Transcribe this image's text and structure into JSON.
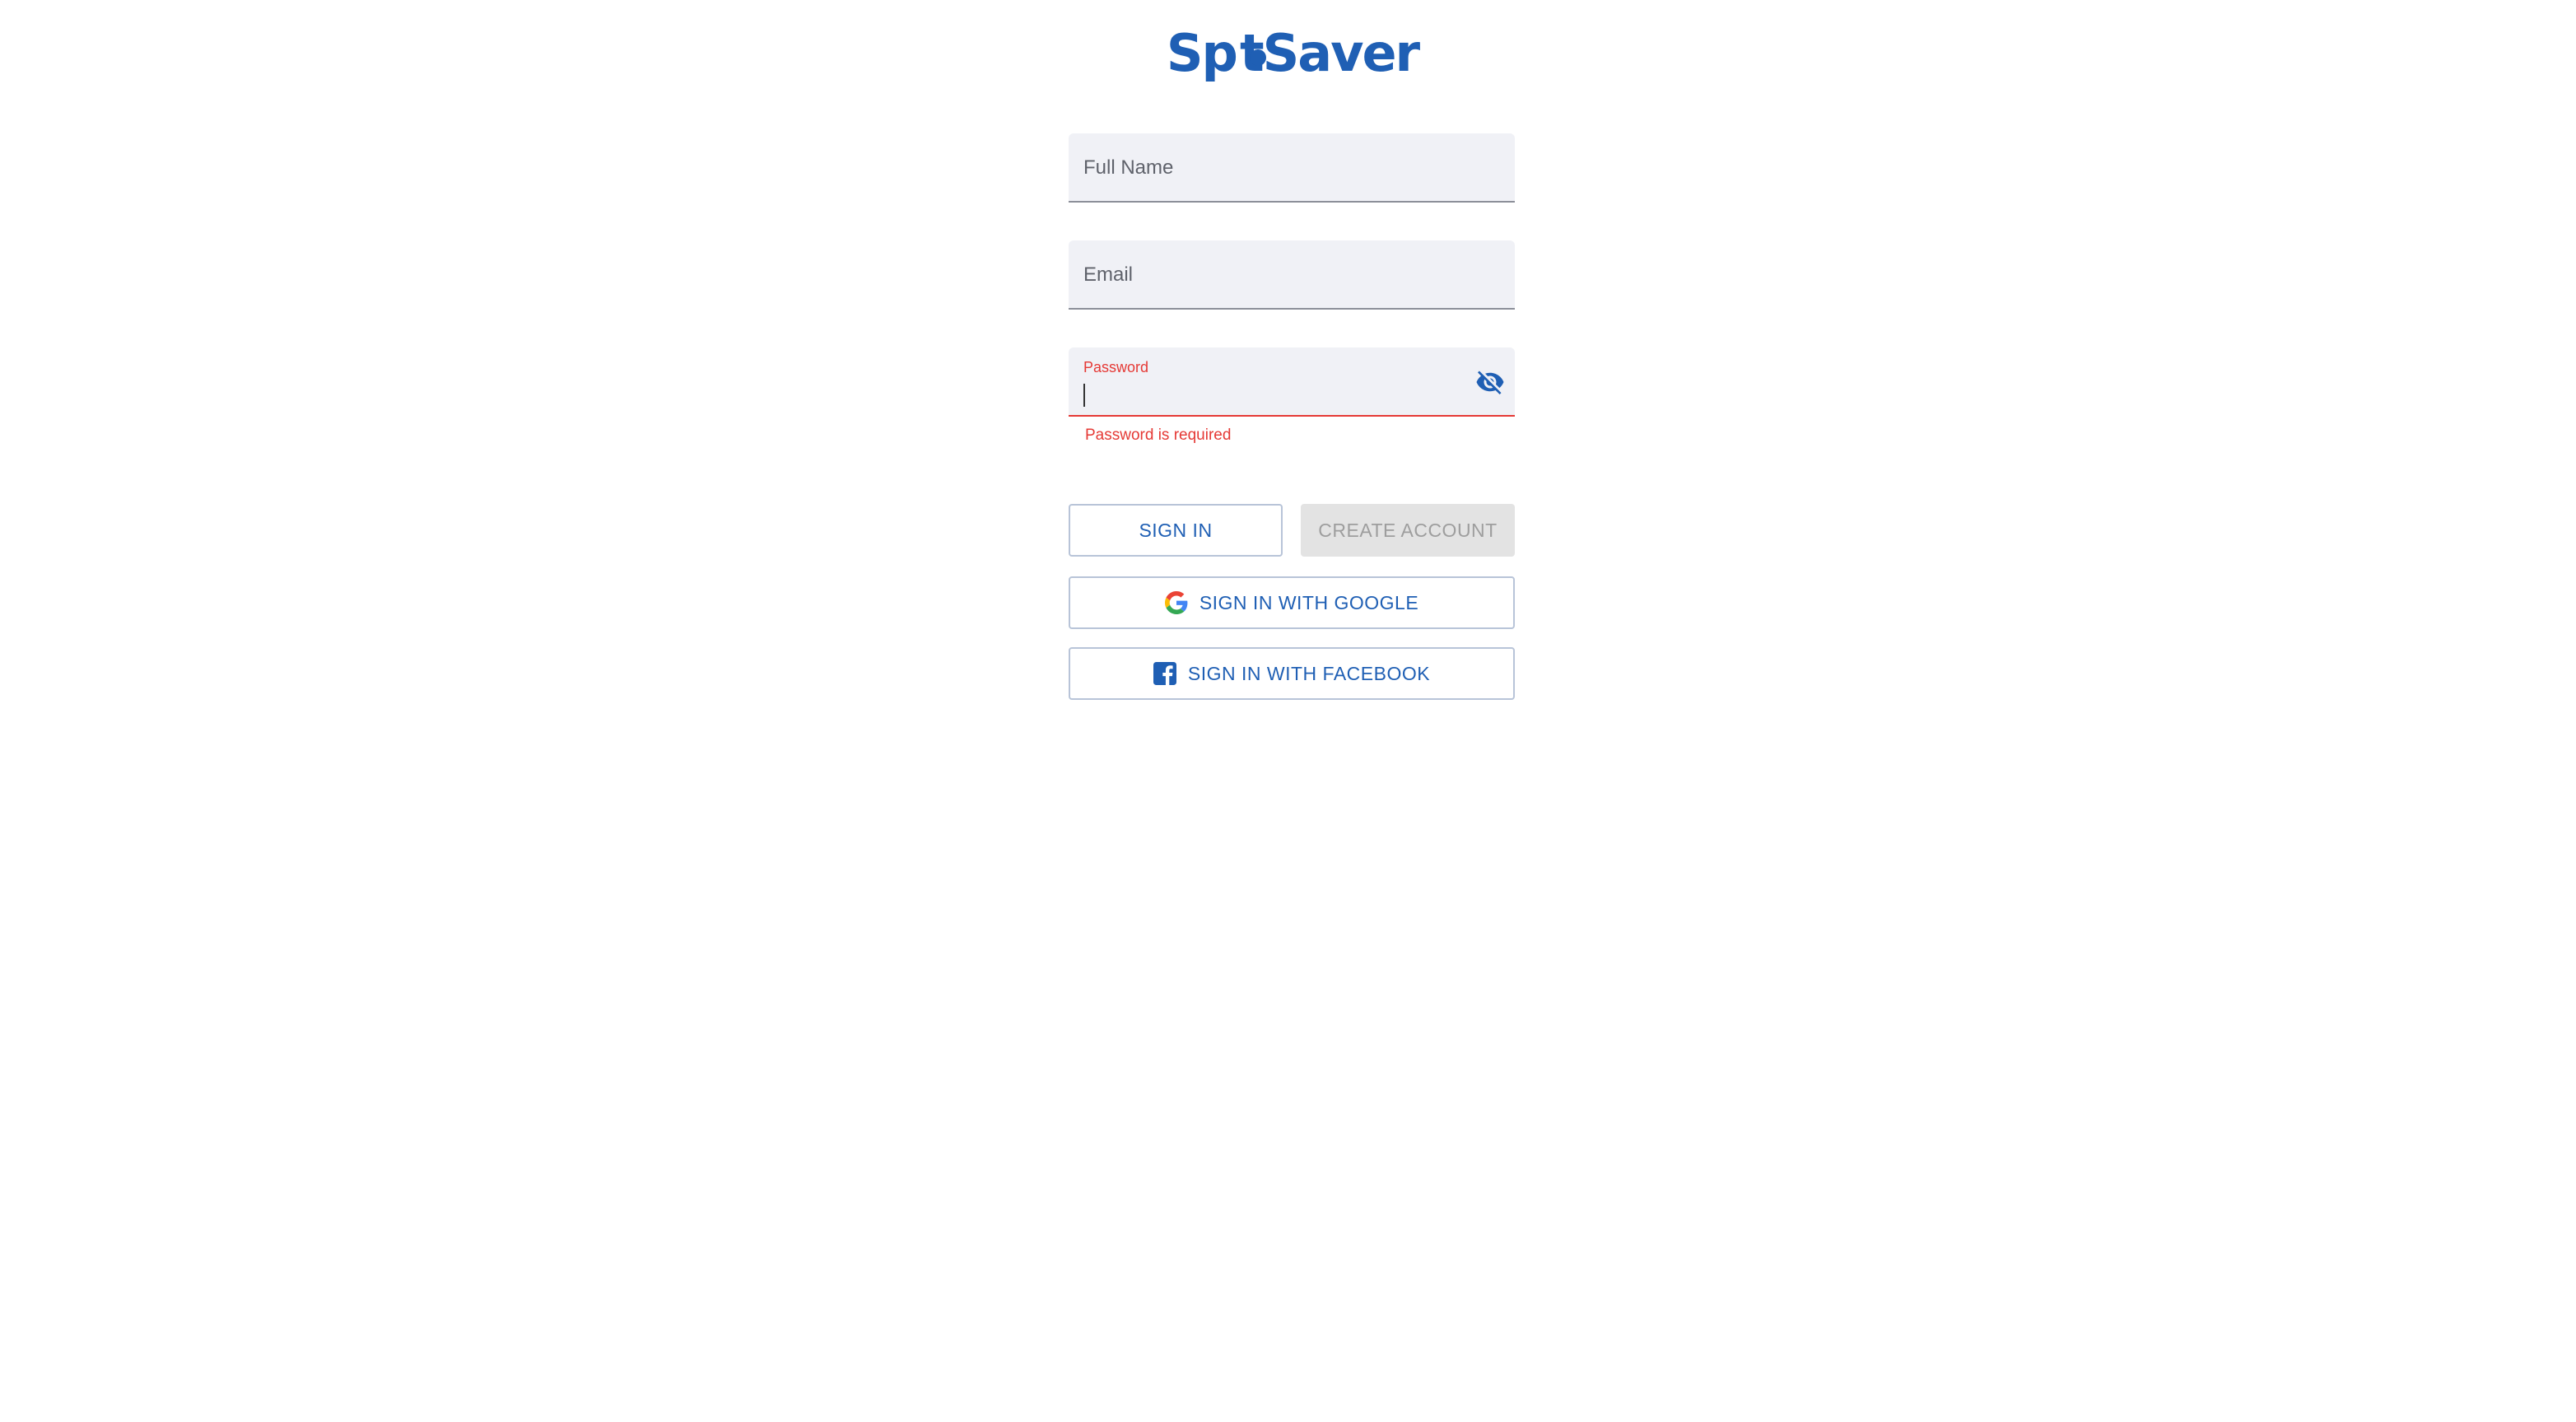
{
  "logo": {
    "text_before": "Sp",
    "text_after": "tSaver",
    "colors": {
      "primary": "#1f5fb4",
      "accent": "#47b3e0"
    }
  },
  "form": {
    "full_name_label": "Full Name",
    "email_label": "Email",
    "password_label": "Password",
    "password_error": "Password is required",
    "password_toggle_icon": "eye-off-icon"
  },
  "buttons": {
    "sign_in": "SIGN IN",
    "create_account": "CREATE ACCOUNT",
    "sign_in_google": "SIGN IN WITH GOOGLE",
    "sign_in_facebook": "SIGN IN WITH FACEBOOK"
  },
  "colors": {
    "brand": "#1f5fb4",
    "error": "#e53935",
    "field_bg": "#f0f1f6",
    "disabled_bg": "#e3e3e3"
  }
}
